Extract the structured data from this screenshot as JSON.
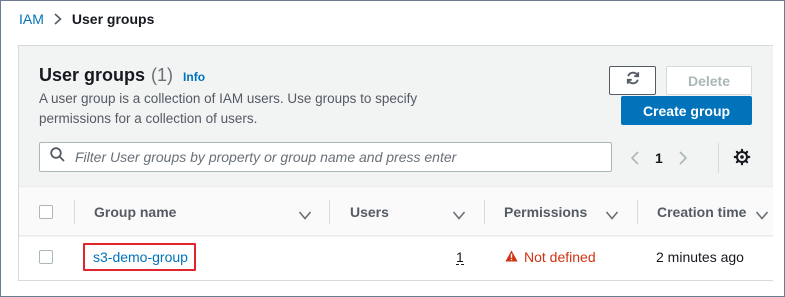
{
  "breadcrumb": {
    "root": "IAM",
    "current": "User groups"
  },
  "header": {
    "title": "User groups",
    "count": "(1)",
    "info": "Info",
    "description": "A user group is a collection of IAM users. Use groups to specify permissions for a collection of users."
  },
  "buttons": {
    "refresh_icon": "refresh-icon",
    "delete": "Delete",
    "create": "Create group"
  },
  "search": {
    "placeholder": "Filter User groups by property or group name and press enter",
    "value": ""
  },
  "pagination": {
    "page": "1"
  },
  "table": {
    "columns": [
      "Group name",
      "Users",
      "Permissions",
      "Creation time"
    ],
    "rows": [
      {
        "group_name": "s3-demo-group",
        "users": "1",
        "permissions": "Not defined",
        "creation_time": "2 minutes ago"
      }
    ]
  },
  "colors": {
    "link": "#0073bb",
    "primary_button": "#0073bb",
    "warning": "#d13212",
    "highlight": "#e0262c"
  }
}
